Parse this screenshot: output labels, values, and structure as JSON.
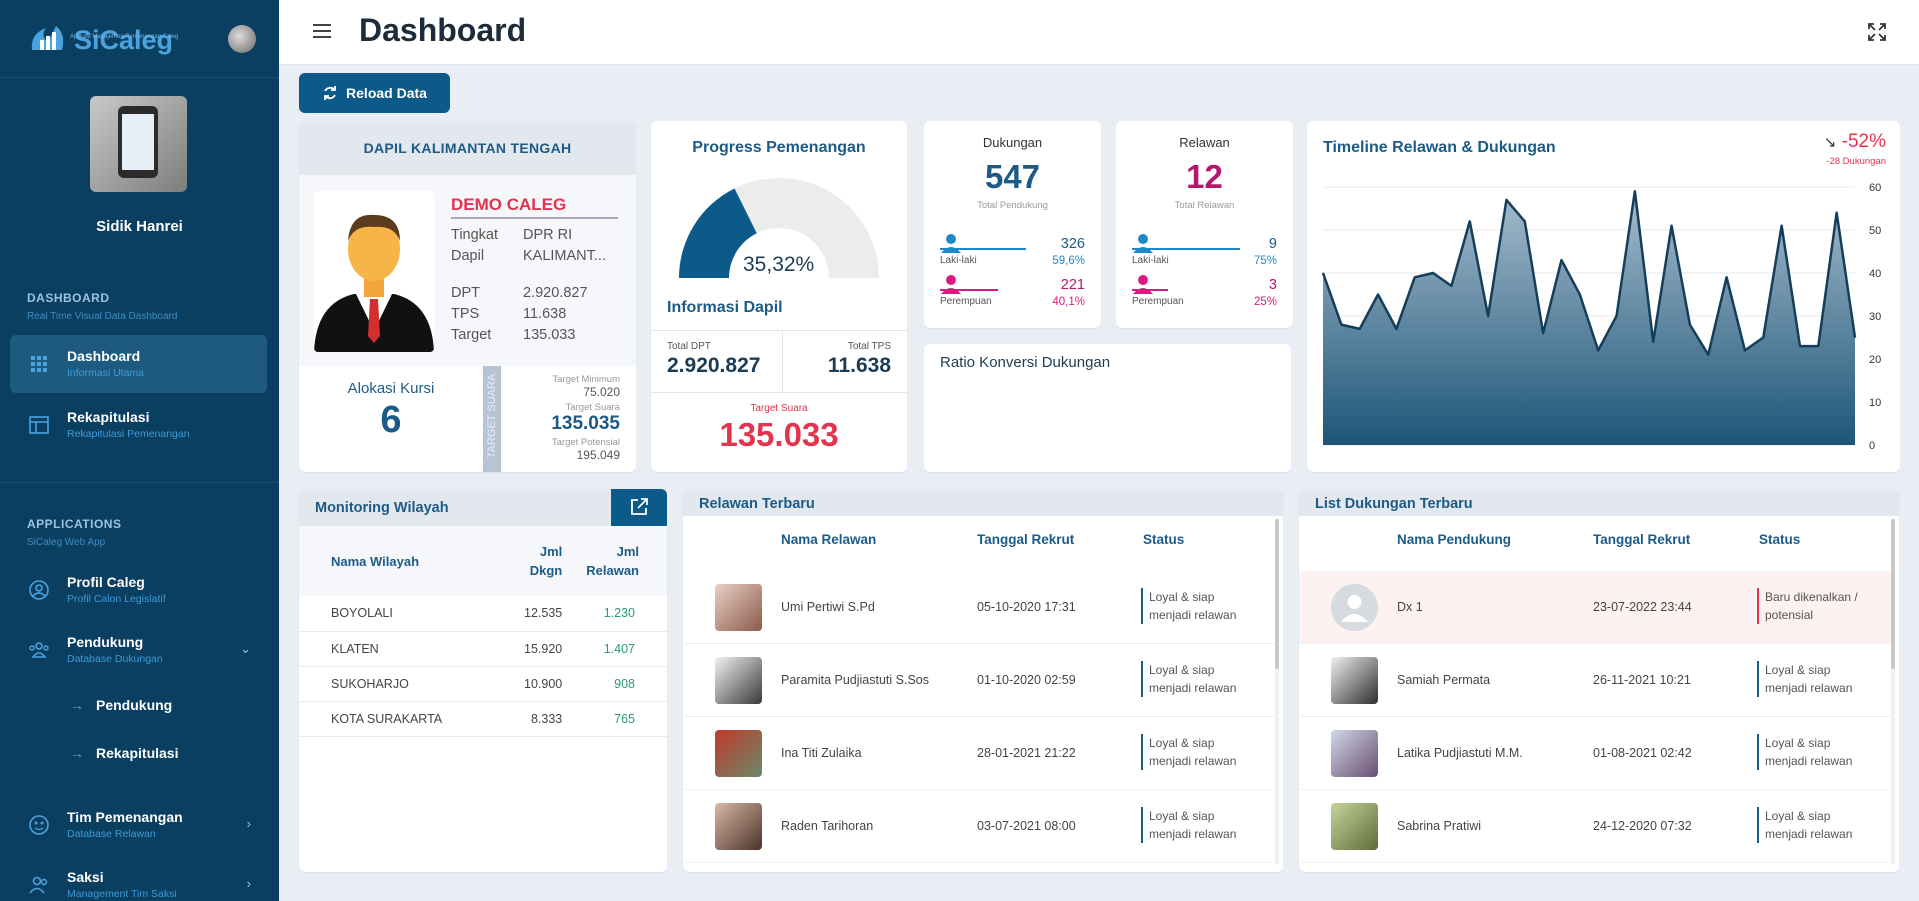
{
  "app": {
    "name": "SiCaleg",
    "tagline": "Aplikasi Manajemen Pemenangan Caleg"
  },
  "user": {
    "name": "Sidik Hanrei"
  },
  "sidebar": {
    "dashboard_section": {
      "title": "DASHBOARD",
      "subtitle": "Real Time Visual Data Dashboard"
    },
    "applications_section": {
      "title": "APPLICATIONS",
      "subtitle": "SiCaleg Web App"
    },
    "items": [
      {
        "label": "Dashboard",
        "sub": "Informasi Utama",
        "icon": "grid-icon"
      },
      {
        "label": "Rekapitulasi",
        "sub": "Rekapitulasi Pemenangan",
        "icon": "table-icon"
      },
      {
        "label": "Profil Caleg",
        "sub": "Profil Calon Legislatif",
        "icon": "user-circle-icon"
      },
      {
        "label": "Pendukung",
        "sub": "Database Dukungan",
        "icon": "users-icon"
      },
      {
        "label": "Tim Pemenangan",
        "sub": "Database Relawan",
        "icon": "team-icon"
      },
      {
        "label": "Saksi",
        "sub": "Management Tim Saksi",
        "icon": "user-group-icon"
      }
    ],
    "submenu": [
      "Pendukung",
      "Rekapitulasi"
    ]
  },
  "header": {
    "title": "Dashboard"
  },
  "reload_label": "Reload Data",
  "dapil": {
    "title": "DAPIL KALIMANTAN TENGAH",
    "candidate": "DEMO CALEG",
    "rows": [
      {
        "k": "Tingkat",
        "v": "DPR RI"
      },
      {
        "k": "Dapil",
        "v": "KALIMANT..."
      },
      {
        "k": "DPT",
        "v": "2.920.827"
      },
      {
        "k": "TPS",
        "v": "11.638"
      },
      {
        "k": "Target",
        "v": "135.033"
      }
    ],
    "kursi_label": "Alokasi Kursi",
    "kursi_value": "6",
    "target_vertical": "TARGET SUARA",
    "target_min_label": "Target Minimum",
    "target_min_value": "75.020",
    "target_suara_label": "Target Suara",
    "target_suara_value": "135.035",
    "target_pot_label": "Target Potensial",
    "target_pot_value": "195.049"
  },
  "progress": {
    "title": "Progress Pemenangan",
    "percent_label": "35,32%",
    "percent": 35.32,
    "info_title": "Informasi Dapil",
    "total_dpt_label": "Total DPT",
    "total_dpt": "2.920.827",
    "total_tps_label": "Total TPS",
    "total_tps": "11.638",
    "target_label": "Target Suara",
    "target_value": "135.033"
  },
  "dukungan": {
    "title": "Dukungan",
    "value": "547",
    "sub": "Total Pendukung",
    "male_label": "Laki-laki",
    "male": "326",
    "male_pct": "59,6%",
    "female_label": "Perempuan",
    "female": "221",
    "female_pct": "40,1%"
  },
  "relawan": {
    "title": "Relawan",
    "value": "12",
    "sub": "Total Relawan",
    "male_label": "Laki-laki",
    "male": "9",
    "male_pct": "75%",
    "female_label": "Perempuan",
    "female": "3",
    "female_pct": "25%"
  },
  "ratio": {
    "title": "Ratio Konversi Dukungan"
  },
  "timeline": {
    "title": "Timeline Relawan & Dukungan",
    "trend": "-52%",
    "trend_sub": "-28 Dukungan"
  },
  "chart_data": {
    "type": "area",
    "title": "Timeline Relawan & Dukungan",
    "ylim": [
      0,
      60
    ],
    "yticks": [
      "60",
      "50",
      "40",
      "30",
      "20",
      "10",
      "0"
    ],
    "values": [
      40,
      28,
      27,
      35,
      27,
      39,
      40,
      37,
      52,
      30,
      57,
      52,
      26,
      43,
      35,
      22,
      30,
      59,
      24,
      51,
      28,
      21,
      39,
      22,
      25,
      51,
      23,
      23,
      54,
      25
    ],
    "grid": true
  },
  "monitoring": {
    "title": "Monitoring Wilayah",
    "columns": [
      "Nama Wilayah",
      "Jml Dkgn",
      "Jml Relawan"
    ],
    "rows": [
      {
        "nama": "BOYOLALI",
        "dkgn": "12.535",
        "relawan": "1.230"
      },
      {
        "nama": "KLATEN",
        "dkgn": "15.920",
        "relawan": "1.407"
      },
      {
        "nama": "SUKOHARJO",
        "dkgn": "10.900",
        "relawan": "908"
      },
      {
        "nama": "KOTA SURAKARTA",
        "dkgn": "8.333",
        "relawan": "765"
      }
    ]
  },
  "relawan_terbaru": {
    "title": "Relawan Terbaru",
    "columns": [
      "Nama Relawan",
      "Tanggal Rekrut",
      "Status"
    ],
    "rows": [
      {
        "nama": "Umi Pertiwi S.Pd",
        "tanggal": "05-10-2020 17:31",
        "status": "Loyal & siap menjadi relawan"
      },
      {
        "nama": "Paramita Pudjiastuti S.Sos",
        "tanggal": "01-10-2020 02:59",
        "status": "Loyal & siap menjadi relawan"
      },
      {
        "nama": "Ina Titi Zulaika",
        "tanggal": "28-01-2021 21:22",
        "status": "Loyal & siap menjadi relawan"
      },
      {
        "nama": "Raden Tarihoran",
        "tanggal": "03-07-2021 08:00",
        "status": "Loyal & siap menjadi relawan"
      }
    ]
  },
  "dukungan_terbaru": {
    "title": "List Dukungan Terbaru",
    "columns": [
      "Nama Pendukung",
      "Tanggal Rekrut",
      "Status"
    ],
    "rows": [
      {
        "nama": "Dx 1",
        "tanggal": "23-07-2022 23:44",
        "status": "Baru dikenalkan / potensial"
      },
      {
        "nama": "Samiah Permata",
        "tanggal": "26-11-2021 10:21",
        "status": "Loyal & siap menjadi relawan"
      },
      {
        "nama": "Latika Pudjiastuti M.M.",
        "tanggal": "01-08-2021 02:42",
        "status": "Loyal & siap menjadi relawan"
      },
      {
        "nama": "Sabrina Pratiwi",
        "tanggal": "24-12-2020 07:32",
        "status": "Loyal & siap menjadi relawan"
      }
    ]
  },
  "colors": {
    "primary": "#0c5a8a",
    "sidebar": "#0b3f61",
    "accent_red": "#e0344f",
    "male": "#1e88c9",
    "female": "#d81b80",
    "green": "#2a9d6f"
  }
}
